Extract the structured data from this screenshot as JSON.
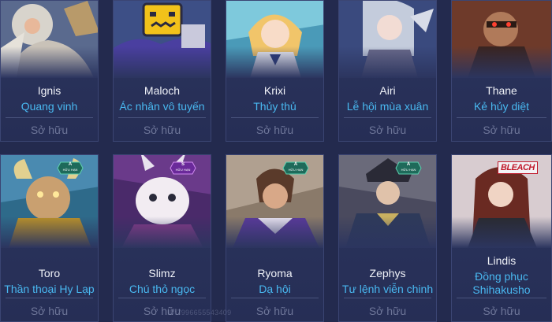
{
  "cards": [
    {
      "name": "Ignis",
      "skin": "Quang vinh",
      "status": "Sở hữu"
    },
    {
      "name": "Maloch",
      "skin": "Ác nhân vô tuyến",
      "status": "Sở hữu"
    },
    {
      "name": "Krixi",
      "skin": "Thủy thủ",
      "status": "Sở hữu"
    },
    {
      "name": "Airi",
      "skin": "Lễ hội mùa xuân",
      "status": "Sở hữu"
    },
    {
      "name": "Thane",
      "skin": "Kẻ hủy diệt",
      "status": "Sở hữu"
    },
    {
      "name": "Toro",
      "skin": "Thần thoại Hy Lạp",
      "status": "Sở hữu",
      "badge": {
        "tier": "A",
        "label": "HỮU HẠN"
      }
    },
    {
      "name": "Slimz",
      "skin": "Chú thỏ ngọc",
      "status": "Sở hữu",
      "badge": {
        "tier": "S",
        "label": "HỮU HẠN"
      }
    },
    {
      "name": "Ryoma",
      "skin": "Dạ hội",
      "status": "Sở hữu",
      "badge": {
        "tier": "A",
        "label": "HỮU HẠN"
      }
    },
    {
      "name": "Zephys",
      "skin": "Tư lệnh viễn chinh",
      "status": "Sở hữu",
      "badge": {
        "tier": "A",
        "label": "HỮU HẠN"
      }
    },
    {
      "name": "Lindis",
      "skin_line1": "Đồng phục",
      "skin_line2": "Shihakusho",
      "status": "Sở hữu",
      "logo": "BLEACH"
    }
  ],
  "watermark": "ID:7996655543409"
}
